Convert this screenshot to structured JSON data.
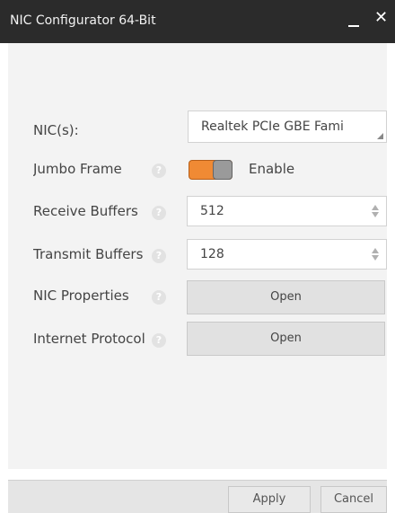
{
  "window": {
    "title": "NIC Configurator 64-Bit",
    "minimize_icon": "minimize-icon",
    "close_icon": "close-icon",
    "close_glyph": "✕"
  },
  "fields": {
    "nic": {
      "label": "NIC(s):",
      "value": "Realtek PCIe GBE Fami"
    },
    "jumbo": {
      "label": "Jumbo Frame",
      "toggle_state": "on",
      "state_label": "Enable"
    },
    "receive": {
      "label": "Receive Buffers",
      "value": "512"
    },
    "transmit": {
      "label": "Transmit Buffers",
      "value": "128"
    },
    "nic_properties": {
      "label": "NIC Properties",
      "button": "Open"
    },
    "internet_protocol": {
      "label": "Internet Protocol",
      "button": "Open"
    }
  },
  "help_glyph": "?",
  "footer": {
    "apply": "Apply",
    "cancel": "Cancel"
  },
  "colors": {
    "titlebar": "#2b2b2b",
    "panel": "#f3f3f3",
    "toggle_on": "#f08a34",
    "button_bg": "#e1e1e1"
  }
}
